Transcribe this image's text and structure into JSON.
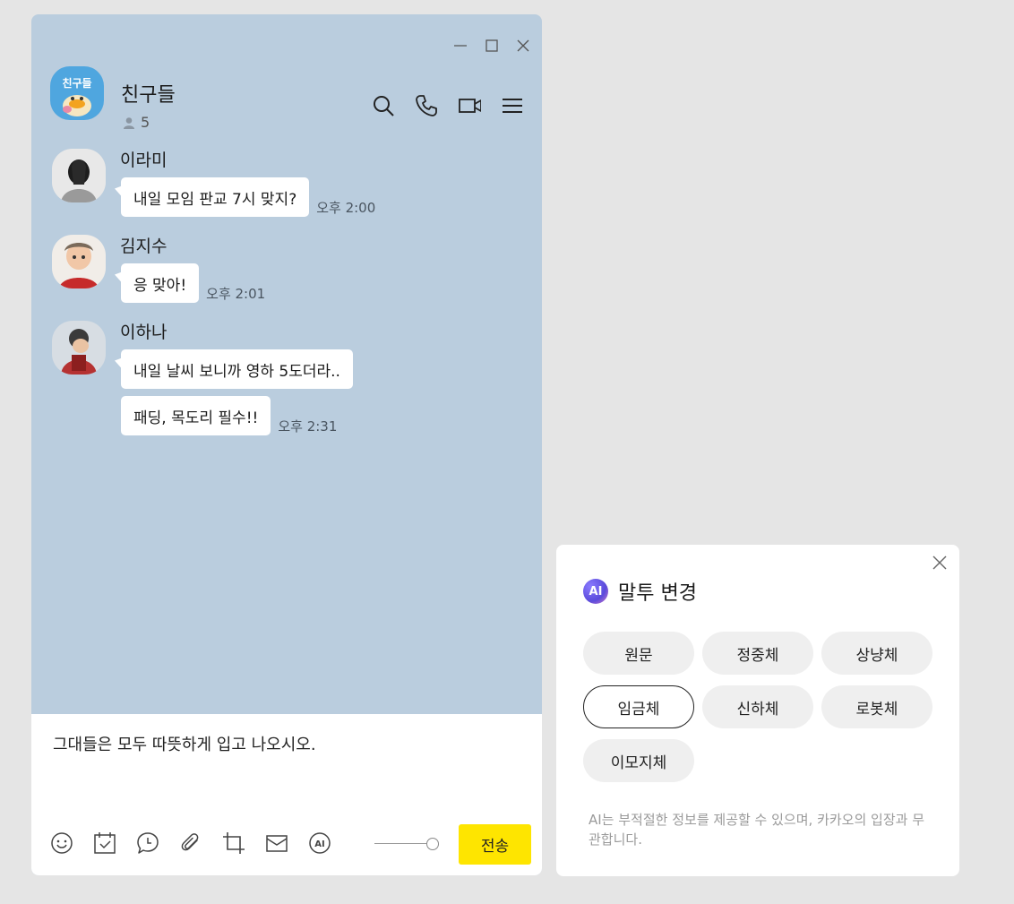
{
  "chat": {
    "room_name": "친구들",
    "member_count": "5",
    "avatar_text": "친구들",
    "messages": [
      {
        "sender": "이라미",
        "bubbles": [
          "내일 모임 판교 7시 맞지?"
        ],
        "time": "오후 2:00"
      },
      {
        "sender": "김지수",
        "bubbles": [
          "응 맞아!"
        ],
        "time": "오후 2:01"
      },
      {
        "sender": "이하나",
        "bubbles": [
          "내일 날씨 보니까 영하 5도더라..",
          "패딩, 목도리 필수!!"
        ],
        "time": "오후 2:31"
      }
    ]
  },
  "composer": {
    "text": "그대들은 모두 따뜻하게 입고 나오시오.",
    "send_label": "전송",
    "toolbar_icons": [
      "emoji-icon",
      "calendar-icon",
      "chat-bubble-icon",
      "attach-icon",
      "crop-icon",
      "mail-icon",
      "ai-icon"
    ],
    "ai_icon_label": "AI"
  },
  "ai_panel": {
    "badge": "AI",
    "title": "말투 변경",
    "tones": [
      "원문",
      "정중체",
      "상냥체",
      "임금체",
      "신하체",
      "로봇체",
      "이모지체"
    ],
    "selected_tone": "임금체",
    "note": "AI는 부적절한 정보를 제공할 수 있으며, 카카오의 입장과 무관합니다."
  },
  "colors": {
    "chat_background": "#bacdde",
    "send_button": "#fee500",
    "page_background": "#e5e5e5"
  }
}
